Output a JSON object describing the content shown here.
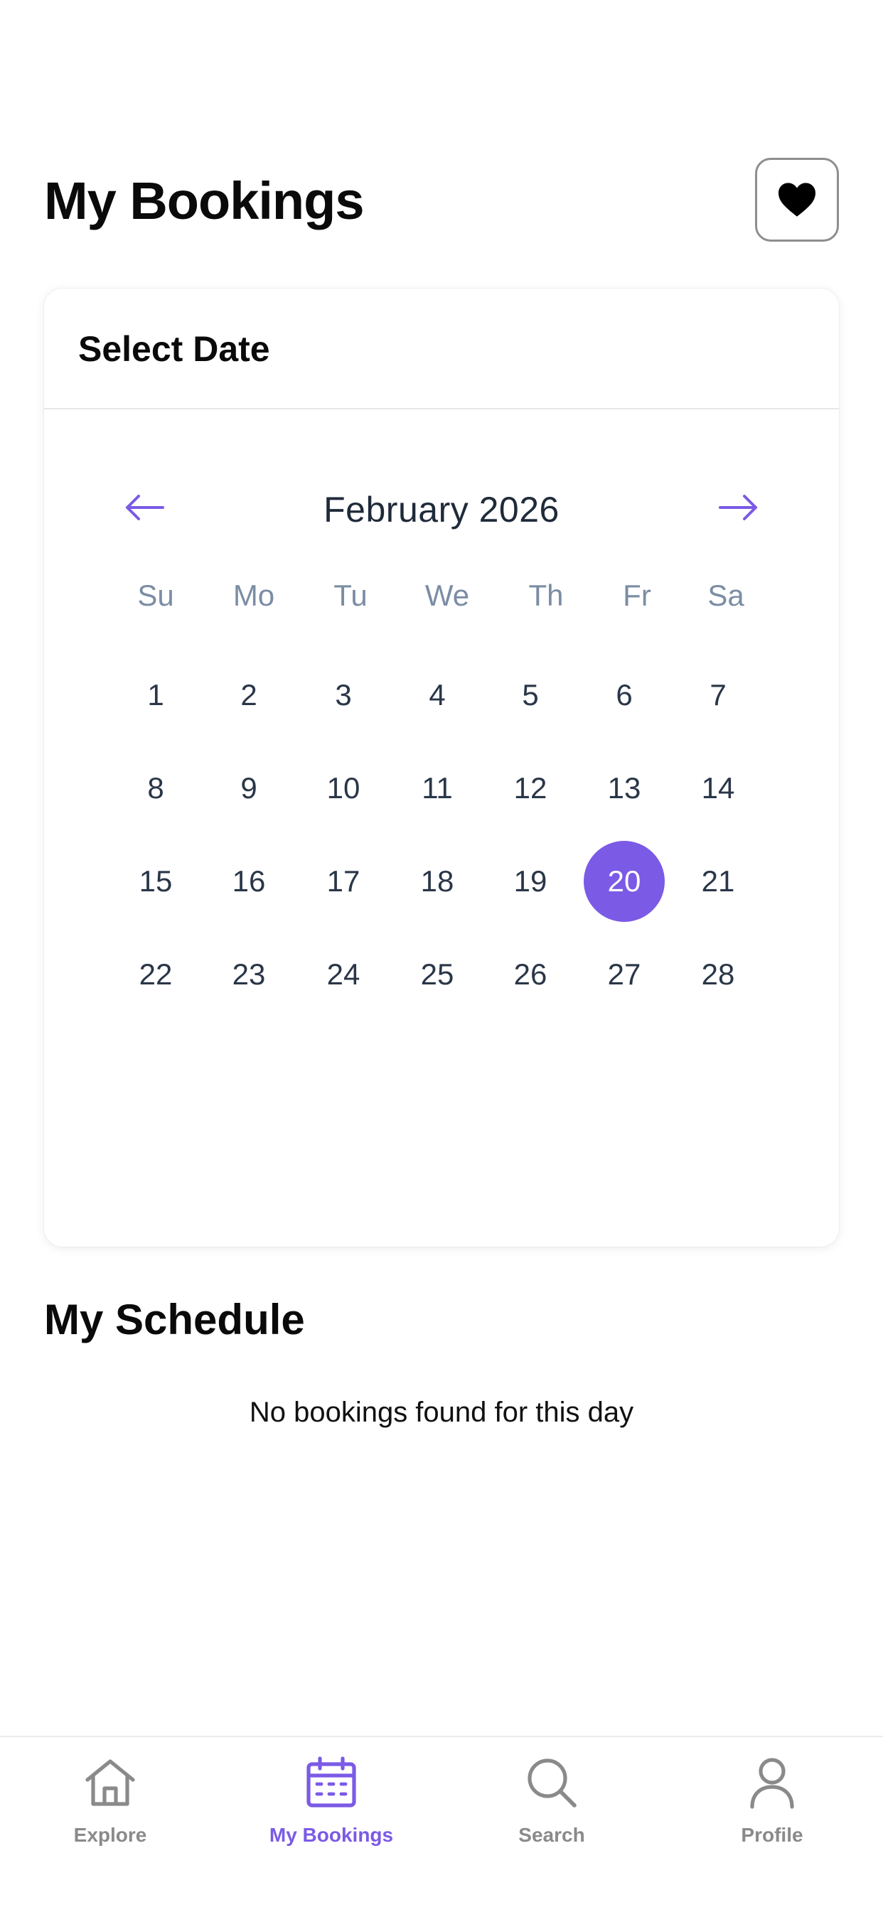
{
  "header": {
    "title": "My Bookings",
    "favorite_icon": "heart-icon"
  },
  "calendar": {
    "title": "Select Date",
    "month_label": "February 2026",
    "prev_icon": "arrow-left-icon",
    "next_icon": "arrow-right-icon",
    "weekdays": [
      "Su",
      "Mo",
      "Tu",
      "We",
      "Th",
      "Fr",
      "Sa"
    ],
    "weeks": [
      [
        "1",
        "2",
        "3",
        "4",
        "5",
        "6",
        "7"
      ],
      [
        "8",
        "9",
        "10",
        "11",
        "12",
        "13",
        "14"
      ],
      [
        "15",
        "16",
        "17",
        "18",
        "19",
        "20",
        "21"
      ],
      [
        "22",
        "23",
        "24",
        "25",
        "26",
        "27",
        "28"
      ]
    ],
    "selected_day": "20",
    "accent_color": "#7B5AE6"
  },
  "schedule": {
    "title": "My Schedule",
    "empty_message": "No bookings found for this day"
  },
  "tabbar": {
    "items": [
      {
        "label": "Explore",
        "icon": "home-icon",
        "active": false
      },
      {
        "label": "My Bookings",
        "icon": "calendar-icon",
        "active": true
      },
      {
        "label": "Search",
        "icon": "search-icon",
        "active": false
      },
      {
        "label": "Profile",
        "icon": "user-icon",
        "active": false
      }
    ]
  }
}
